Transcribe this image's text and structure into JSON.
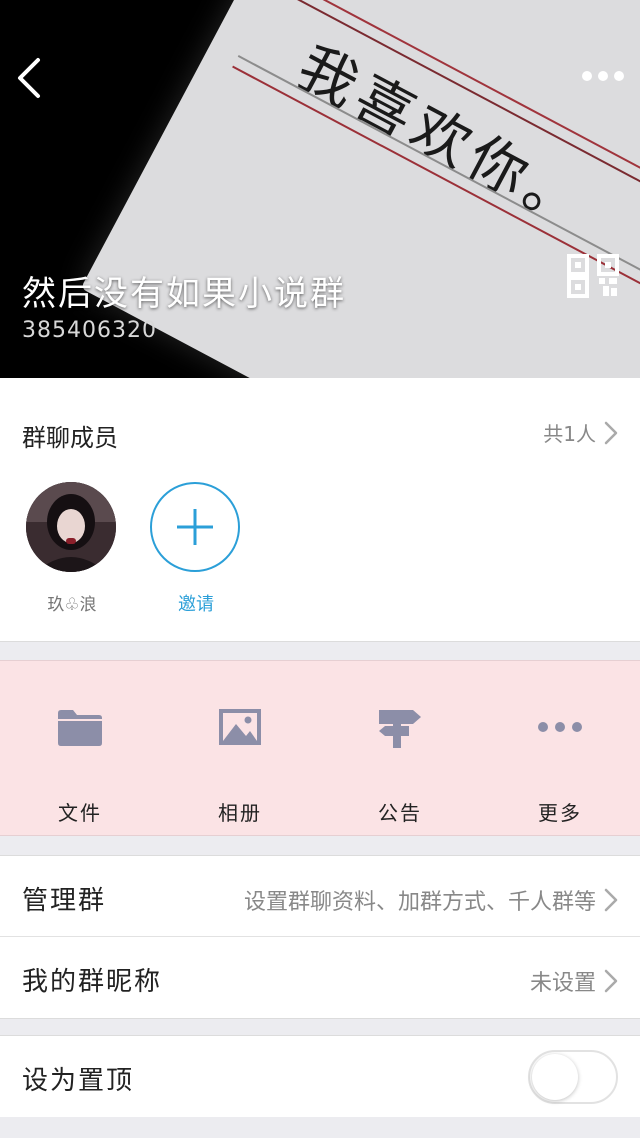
{
  "header": {
    "group_name": "然后没有如果小说群",
    "group_id": "385406320",
    "paper_text": "我喜欢你。",
    "back_icon": "chevron-left-icon",
    "more_icon": "ellipsis-icon",
    "qr_icon": "qr-code-icon"
  },
  "members": {
    "title": "群聊成员",
    "count_label": "共1人",
    "list": [
      {
        "name": "玖♧浪"
      }
    ],
    "invite_label": "邀请"
  },
  "functions": [
    {
      "label": "文件",
      "icon": "folder-icon"
    },
    {
      "label": "相册",
      "icon": "image-icon"
    },
    {
      "label": "公告",
      "icon": "signpost-icon"
    },
    {
      "label": "更多",
      "icon": "more-dots-icon"
    }
  ],
  "settings": {
    "manage": {
      "label": "管理群",
      "value": "设置群聊资料、加群方式、千人群等"
    },
    "nickname": {
      "label": "我的群昵称",
      "value": "未设置"
    },
    "pin": {
      "label": "设为置顶",
      "enabled": false
    }
  },
  "colors": {
    "accent": "#2b9fd8",
    "function_bg": "#fbe3e5",
    "icon_color": "#8c8ea8"
  }
}
